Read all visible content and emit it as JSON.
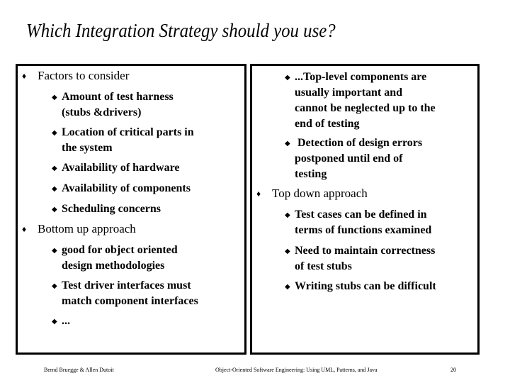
{
  "slide": {
    "title": "Which Integration Strategy should you use?"
  },
  "left_panel": {
    "items": [
      {
        "level": 1,
        "text": "Factors to consider",
        "children": [
          {
            "text": "Amount of test harness\n(stubs &drivers)"
          },
          {
            "text": "Location of critical parts in\nthe system"
          },
          {
            "text": "Availability of hardware"
          },
          {
            "text": "Availability of components"
          },
          {
            "text": "Scheduling concerns"
          }
        ]
      },
      {
        "level": 1,
        "text": "Bottom up approach",
        "children": [
          {
            "text": "good for object oriented\ndesign methodologies"
          },
          {
            "text": "Test driver interfaces must\nmatch component interfaces"
          },
          {
            "text": "..."
          }
        ]
      }
    ]
  },
  "right_panel": {
    "pre_items": [
      {
        "text": "...Top-level components are\nusually important and\ncannot be neglected up to the\nend of testing"
      },
      {
        "text": " Detection of design errors\npostponed until end of\ntesting"
      }
    ],
    "items": [
      {
        "level": 1,
        "text": "Top down approach",
        "children": [
          {
            "text": "Test cases can be defined in\nterms of functions examined"
          },
          {
            "text": "Need to maintain correctness\nof test stubs"
          },
          {
            "text": "Writing stubs can be difficult"
          }
        ]
      }
    ]
  },
  "footer": {
    "authors": "Bernd Bruegge & Allen Dutoit",
    "book": "Object-Oriented Software Engineering: Using UML, Patterns, and Java",
    "page": "20"
  },
  "icons": {
    "level1_bullet": "♦",
    "level2_bullet": "◆"
  }
}
